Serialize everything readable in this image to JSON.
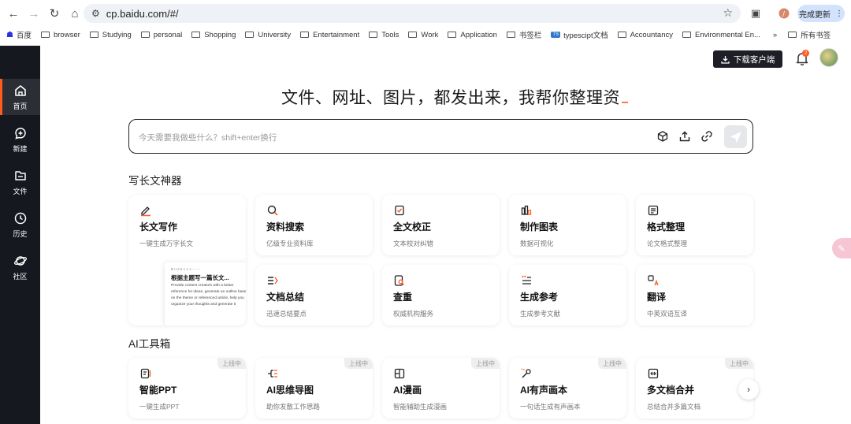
{
  "browser": {
    "url": "cp.baidu.com/#/",
    "update_label": "完成更新",
    "bookmarks": [
      "百度",
      "browser",
      "Studying",
      "personal",
      "Shopping",
      "University",
      "Entertainment",
      "Tools",
      "Work",
      "Application",
      "书签栏",
      "typescipt文档",
      "Accountancy",
      "Environmental En..."
    ],
    "more_bookmarks": "»",
    "all_bookmarks": "所有书签"
  },
  "sidebar": {
    "items": [
      {
        "label": "首页",
        "icon": "home-icon",
        "active": true
      },
      {
        "label": "新建",
        "icon": "new-chat-icon"
      },
      {
        "label": "文件",
        "icon": "folder-icon"
      },
      {
        "label": "历史",
        "icon": "clock-icon"
      },
      {
        "label": "社区",
        "icon": "planet-icon"
      }
    ]
  },
  "header": {
    "download_label": "下载客户端",
    "notification_count": "2"
  },
  "hero": {
    "title": "文件、网址、图片，都发出来，我帮你整理资"
  },
  "prompt": {
    "placeholder": "今天需要我做些什么？shift+enter换行"
  },
  "writing_section": {
    "title": "写长文神器",
    "cards": [
      {
        "title": "长文写作",
        "desc": "一键生成万字长文",
        "icon": "pen-icon"
      },
      {
        "title": "资料搜索",
        "desc": "亿级专业资料库",
        "icon": "search-icon"
      },
      {
        "title": "全文校正",
        "desc": "文本校对纠错",
        "icon": "proofread-icon"
      },
      {
        "title": "制作图表",
        "desc": "数据可视化",
        "icon": "chart-icon"
      },
      {
        "title": "格式整理",
        "desc": "论文格式整理",
        "icon": "format-icon"
      },
      {
        "title": "文档总结",
        "desc": "迅速总结要点",
        "icon": "summary-icon"
      },
      {
        "title": "查重",
        "desc": "权威机构服务",
        "icon": "plagiarism-icon"
      },
      {
        "title": "生成参考",
        "desc": "生成参考文献",
        "icon": "quote-icon"
      },
      {
        "title": "翻译",
        "desc": "中英双语互译",
        "icon": "translate-icon"
      }
    ],
    "preview": {
      "toolbar": "B I U S ≡ ≡ ≡ ⋯ ⋯",
      "title": "根据主题写一篇长文...",
      "text": "Provide content creators with a better reference for ideas, generate an outline based on the theme or referenced article, help you organize your thoughts and generate it"
    }
  },
  "ai_section": {
    "title": "AI工具箱",
    "tag": "上线中",
    "cards": [
      {
        "title": "智能PPT",
        "desc": "一键生成PPT",
        "icon": "ppt-icon"
      },
      {
        "title": "AI思维导图",
        "desc": "助你发散工作思路",
        "icon": "mindmap-icon"
      },
      {
        "title": "AI漫画",
        "desc": "智能辅助生成漫画",
        "icon": "comic-icon"
      },
      {
        "title": "AI有声画本",
        "desc": "一句话生成有声画本",
        "icon": "audiobook-icon"
      },
      {
        "title": "多文档合并",
        "desc": "总结合并多篇文档",
        "icon": "merge-icon"
      }
    ]
  }
}
